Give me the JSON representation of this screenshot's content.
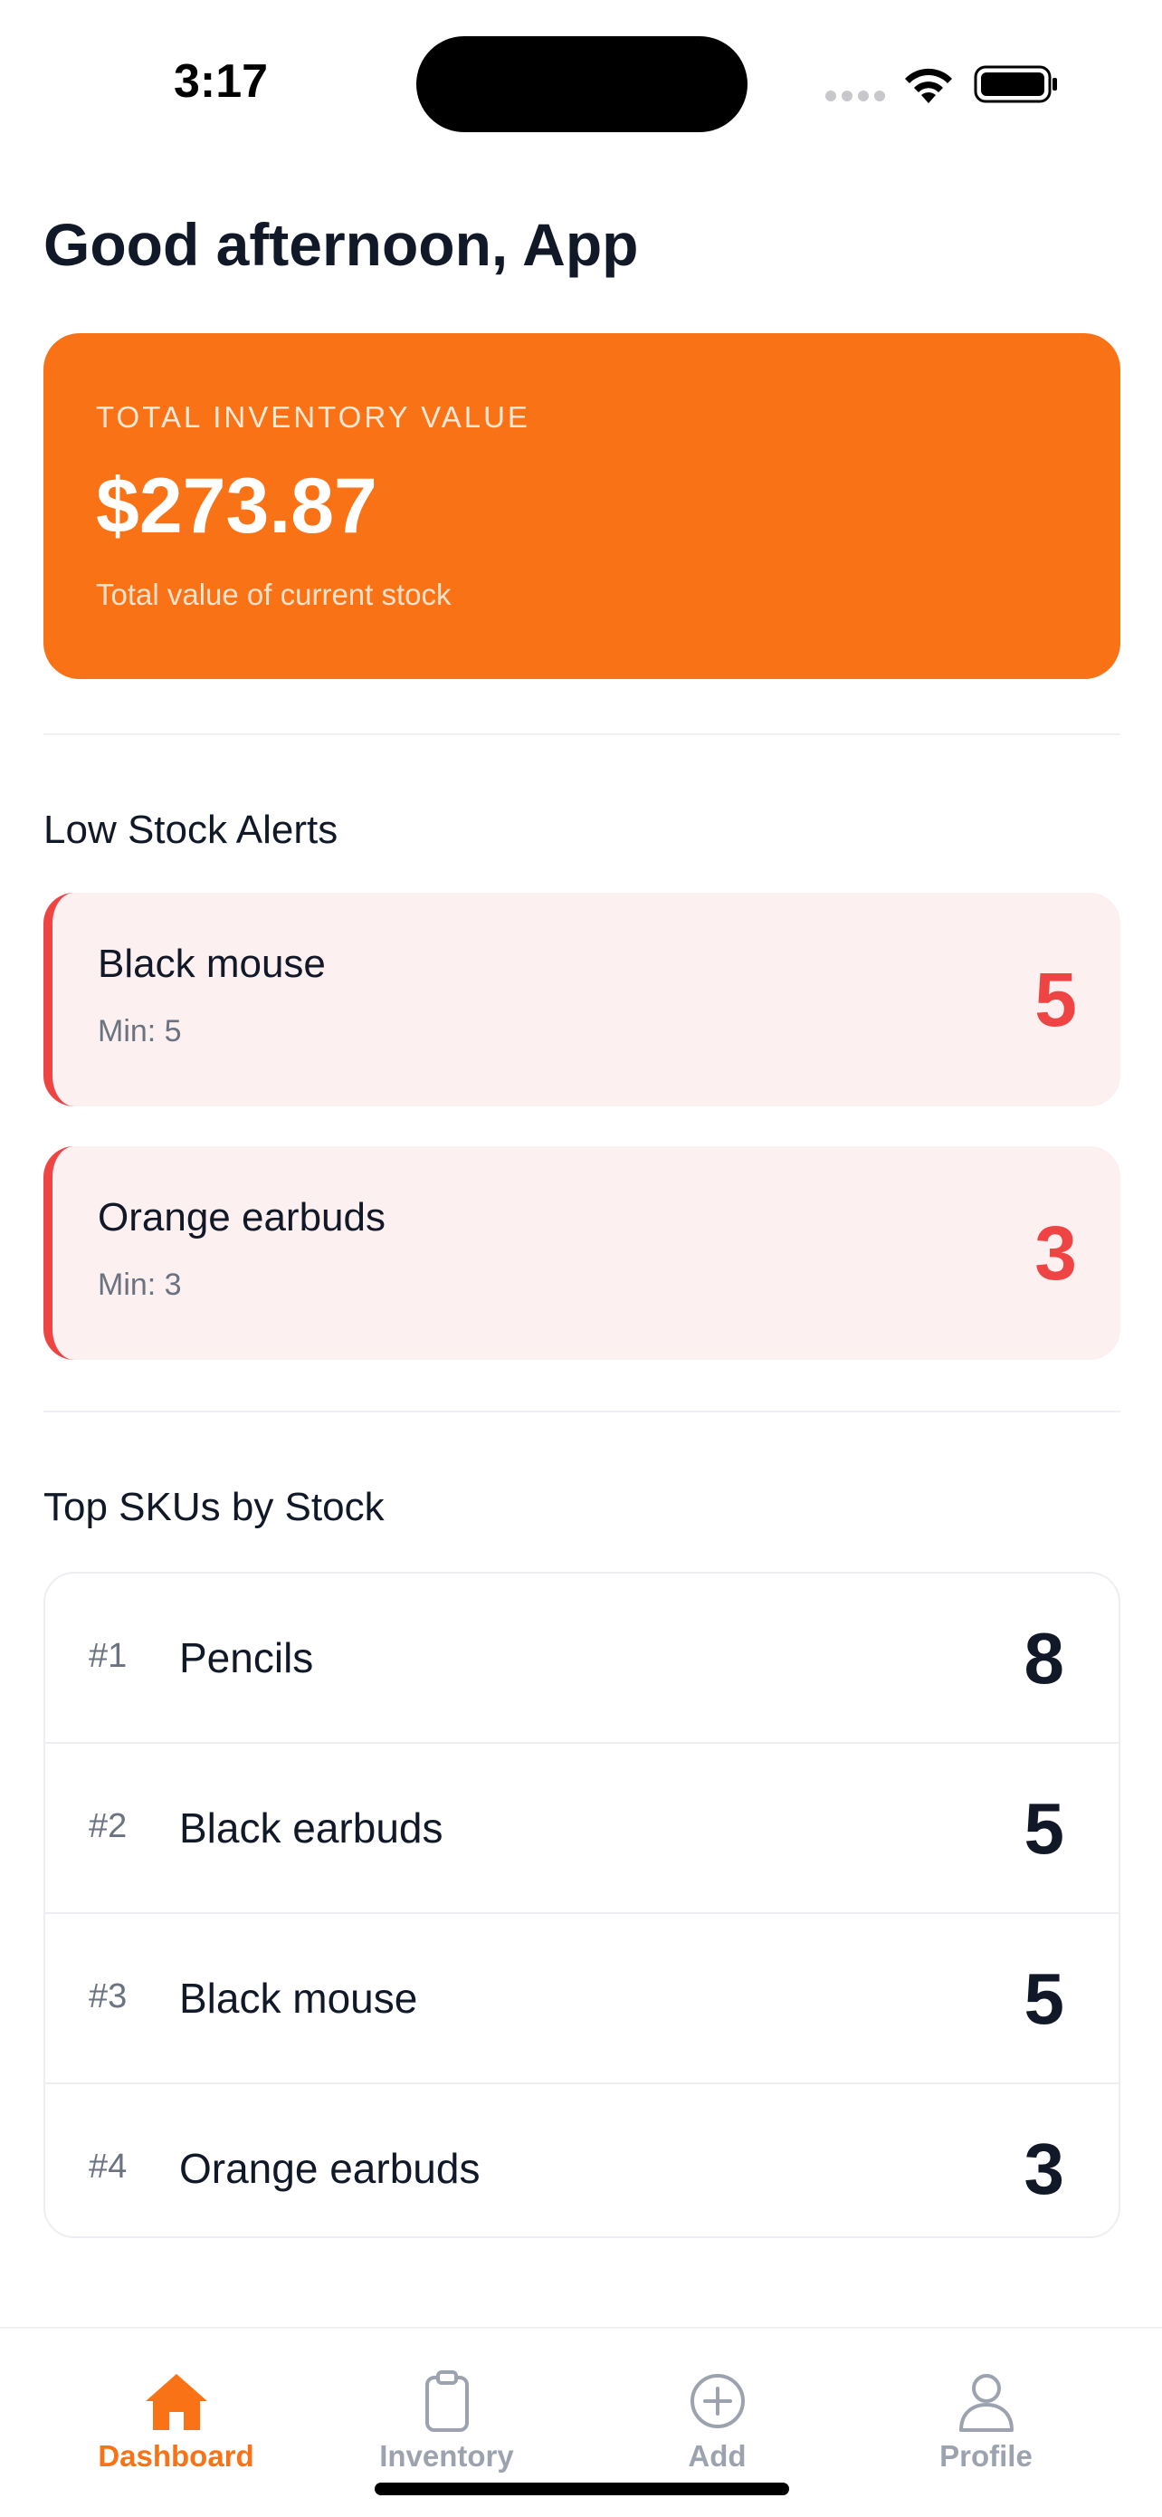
{
  "status_bar": {
    "time": "3:17"
  },
  "greeting": "Good afternoon, App",
  "inventory_value_card": {
    "label": "TOTAL INVENTORY VALUE",
    "amount": "$273.87",
    "subtitle": "Total value of current stock",
    "color": "#f97316"
  },
  "low_stock": {
    "title": "Low Stock Alerts",
    "items": [
      {
        "name": "Black mouse",
        "min": "Min: 5",
        "qty": "5"
      },
      {
        "name": "Orange earbuds",
        "min": "Min: 3",
        "qty": "3"
      }
    ],
    "alert_color": "#ef4444"
  },
  "top_skus": {
    "title": "Top SKUs by Stock",
    "items": [
      {
        "rank": "#1",
        "name": "Pencils",
        "qty": "8"
      },
      {
        "rank": "#2",
        "name": "Black earbuds",
        "qty": "5"
      },
      {
        "rank": "#3",
        "name": "Black mouse",
        "qty": "5"
      },
      {
        "rank": "#4",
        "name": "Orange earbuds",
        "qty": "3"
      }
    ]
  },
  "tab_bar": {
    "active": "Dashboard",
    "tabs": [
      {
        "label": "Dashboard",
        "icon": "home-icon"
      },
      {
        "label": "Inventory",
        "icon": "clipboard-icon"
      },
      {
        "label": "Add",
        "icon": "plus-circle-icon"
      },
      {
        "label": "Profile",
        "icon": "user-icon"
      }
    ]
  }
}
